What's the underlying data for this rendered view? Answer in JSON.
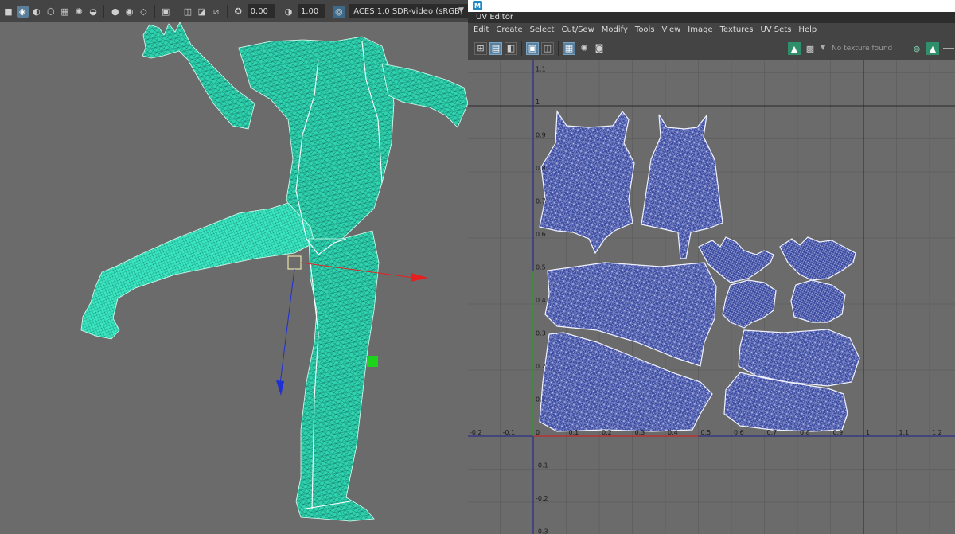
{
  "viewport": {
    "toolbar": {
      "exposure_value": "0.00",
      "gamma_value": "1.00",
      "color_management": "ACES 1.0 SDR-video (sRGB)",
      "icons": [
        "camera-icon",
        "cube-icon",
        "shaded-icon",
        "wireframe-icon",
        "texture-icon",
        "light-icon",
        "shadow-icon",
        "ao-icon",
        "motion-blur-icon",
        "aa-icon",
        "isolate-icon",
        "xray-icon",
        "xray-joints-icon",
        "xray-active-icon",
        "backface-icon",
        "exposure-icon",
        "gamma-icon",
        "color-management-icon"
      ]
    },
    "colors": {
      "background": "#6b6b6b",
      "wire": "#35e3b8",
      "manip_x": "#e81f1f",
      "manip_z": "#1d2fd6",
      "manip_handle": "#2ed22e"
    }
  },
  "uv_editor": {
    "title": "UV Editor",
    "menu": [
      "Edit",
      "Create",
      "Select",
      "Cut/Sew",
      "Modify",
      "Tools",
      "View",
      "Image",
      "Textures",
      "UV Sets",
      "Help"
    ],
    "toolbar": {
      "icons": [
        "uv-shell-border-icon",
        "checker-display-icon",
        "texture-borders-icon",
        "dim-image-icon",
        "shaded-uv-icon",
        "distortion-icon",
        "grid-icon",
        "pixel-snap-icon",
        "snapshot-icon"
      ],
      "right_icons": [
        "image-icon",
        "checker-icon",
        "dropdown-icon",
        "globe-icon",
        "image-toggle-icon"
      ],
      "texture_status": "No texture found"
    },
    "axis": {
      "x_ticks": [
        "-0.2",
        "-0.1",
        "0",
        "0.1",
        "0.2",
        "0.3",
        "0.4",
        "0.5",
        "0.6",
        "0.7",
        "0.8",
        "0.9",
        "1",
        "1.1",
        "1.2"
      ],
      "y_ticks": [
        "1.1",
        "1",
        "0.9",
        "0.8",
        "0.7",
        "0.6",
        "0.5",
        "0.4",
        "0.3",
        "0.2",
        "0.1",
        "-0.1",
        "-0.2",
        "-0.3"
      ],
      "visible_x_range": [
        -0.2,
        1.25
      ],
      "visible_y_range": [
        -0.3,
        1.15
      ]
    },
    "colors": {
      "background": "#6b6b6b",
      "grid": "#5e5e5e",
      "shell_fill": "#3a4aa0",
      "shell_wire": "#d8dcff",
      "u_axis": "#c32828",
      "v_axis": "#2c9a2c",
      "uv_boundary": "#1f1f8f"
    }
  }
}
